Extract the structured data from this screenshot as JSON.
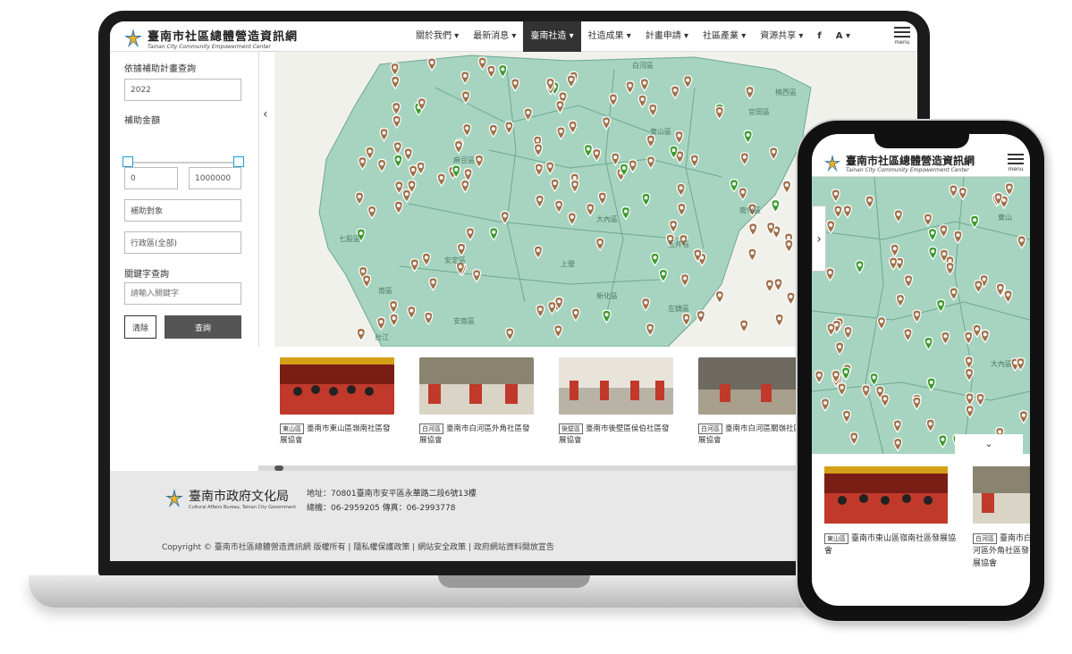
{
  "site": {
    "title": "臺南市社區總體營造資訊網",
    "subtitle": "Tainan City Community Empowerment Center"
  },
  "nav": {
    "items": [
      "關於我們 ▾",
      "最新消息 ▾",
      "臺南社造 ▾",
      "社造成果 ▾",
      "計畫申請 ▾",
      "社區產業 ▾",
      "資源共享 ▾"
    ],
    "active_index": 2,
    "facebook": "f",
    "font_size": "A ▾",
    "menu_label": "menu"
  },
  "sidebar": {
    "plan_label": "依據補助計畫查詢",
    "year_value": "2022",
    "amount_label": "補助金額",
    "amount_min": "0",
    "amount_max": "1000000",
    "target_placeholder": "補助對象",
    "district_value": "行政區(全部)",
    "keyword_label": "關鍵字查詢",
    "keyword_placeholder": "請輸入關鍵字",
    "clear_label": "清除",
    "search_label": "查詢",
    "toggle": "‹"
  },
  "map": {
    "district_labels": [
      "白河區",
      "東山區",
      "七股區",
      "麻豆區",
      "安定區",
      "大內區",
      "玉井區",
      "南化區",
      "新化區",
      "左鎮區",
      "南區",
      "台江",
      "安南區",
      "楠西區",
      "官田區",
      "上營"
    ],
    "expand_icon": "⌄",
    "colors": {
      "land": "#a6d4c0",
      "border": "#6ea892",
      "pin_brown": "#a0704a",
      "pin_green": "#3c9a2e"
    }
  },
  "cards": [
    {
      "tag": "東山區",
      "title": "臺南市東山區嶺南社區發展協會"
    },
    {
      "tag": "白河區",
      "title": "臺南市白河區外角社區發展協會"
    },
    {
      "tag": "後壁區",
      "title": "臺南市後壁區侯伯社區發展協會"
    },
    {
      "tag": "白河區",
      "title": "臺南市白河區關嶺社區發展協會"
    }
  ],
  "footer": {
    "org_name": "臺南市政府文化局",
    "org_en": "Cultural Affairs Bureau, Tainan City Government",
    "address": "地址：70801臺南市安平區永華路二段6號13樓",
    "phone": "總機：06-2959205 傳真：06-2993778",
    "copyright": "Copyright © 臺南市社區總體營造資訊網 版權所有 | 隱私權保護政策 | 網站安全政策 | 政府網站資料開放宣告"
  },
  "phone": {
    "title": "臺南市社區總體營造資訊網",
    "subtitle": "Tainan City Community Empowerment Center",
    "menu_label": "menu",
    "toggle": "›",
    "expand_icon": "⌄",
    "district_labels": [
      "東山",
      "大內區"
    ],
    "cards": [
      {
        "tag": "東山區",
        "title": "臺南市東山區嶺南社區發展協會"
      },
      {
        "tag": "白河區",
        "title": "臺南市白河區外角社區發展協會"
      }
    ]
  }
}
